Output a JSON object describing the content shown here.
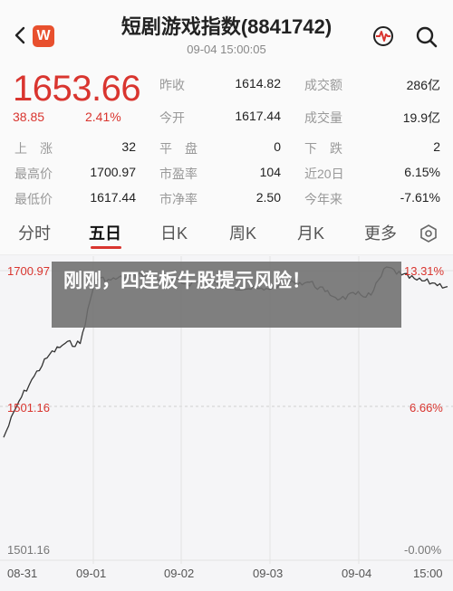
{
  "header": {
    "title": "短剧游戏指数(8841742)",
    "subtitle": "09-04  15:00:05",
    "logo_text": "W",
    "icons": [
      "back-arrow-icon",
      "pulse-icon",
      "search-icon"
    ]
  },
  "quote": {
    "price": "1653.66",
    "change": "38.85",
    "change_pct": "2.41%",
    "price_color": "#d9352f",
    "stats": {
      "prev_close": {
        "label": "昨收",
        "value": "1614.82"
      },
      "open": {
        "label": "今开",
        "value": "1617.44"
      },
      "turnover": {
        "label": "成交额",
        "value": "286亿"
      },
      "volume": {
        "label": "成交量",
        "value": "19.9亿"
      },
      "up": {
        "label": "上　涨",
        "value": "32"
      },
      "flat": {
        "label": "平　盘",
        "value": "0"
      },
      "down": {
        "label": "下　跌",
        "value": "2"
      },
      "high": {
        "label": "最高价",
        "value": "1700.97"
      },
      "pe": {
        "label": "市盈率",
        "value": "104"
      },
      "d20": {
        "label": "近20日",
        "value": "6.15%"
      },
      "low": {
        "label": "最低价",
        "value": "1617.44"
      },
      "pb": {
        "label": "市净率",
        "value": "2.50"
      },
      "ytd": {
        "label": "今年来",
        "value": "-7.61%"
      }
    }
  },
  "tabs": [
    "分时",
    "五日",
    "日K",
    "周K",
    "月K",
    "更多"
  ],
  "active_tab": "五日",
  "chart": {
    "y_left": [
      "1700.97",
      "1501.16",
      "1501.16"
    ],
    "y_right": [
      "13.31%",
      "6.66%",
      "-0.00%"
    ],
    "x_labels": [
      "08-31",
      "09-01",
      "09-02",
      "09-03",
      "09-04",
      "15:00"
    ]
  },
  "chart_data": {
    "type": "line",
    "x": [
      "08-31",
      "09-01",
      "09-02",
      "09-03",
      "09-04",
      "15:00"
    ],
    "series": [
      {
        "values": [
          1470,
          1520,
          1555,
          1585,
          1600,
          1600,
          1690,
          1688,
          1692,
          1696,
          1690,
          1688,
          1683,
          1686,
          1682,
          1679,
          1676,
          1674,
          1682,
          1684,
          1685,
          1672,
          1662,
          1668,
          1667,
          1706,
          1695,
          1688,
          1684,
          1679
        ]
      }
    ],
    "ylim": [
      1300,
      1701
    ]
  },
  "overlay": {
    "text": "刚刚，四连板牛股提示风险！"
  }
}
